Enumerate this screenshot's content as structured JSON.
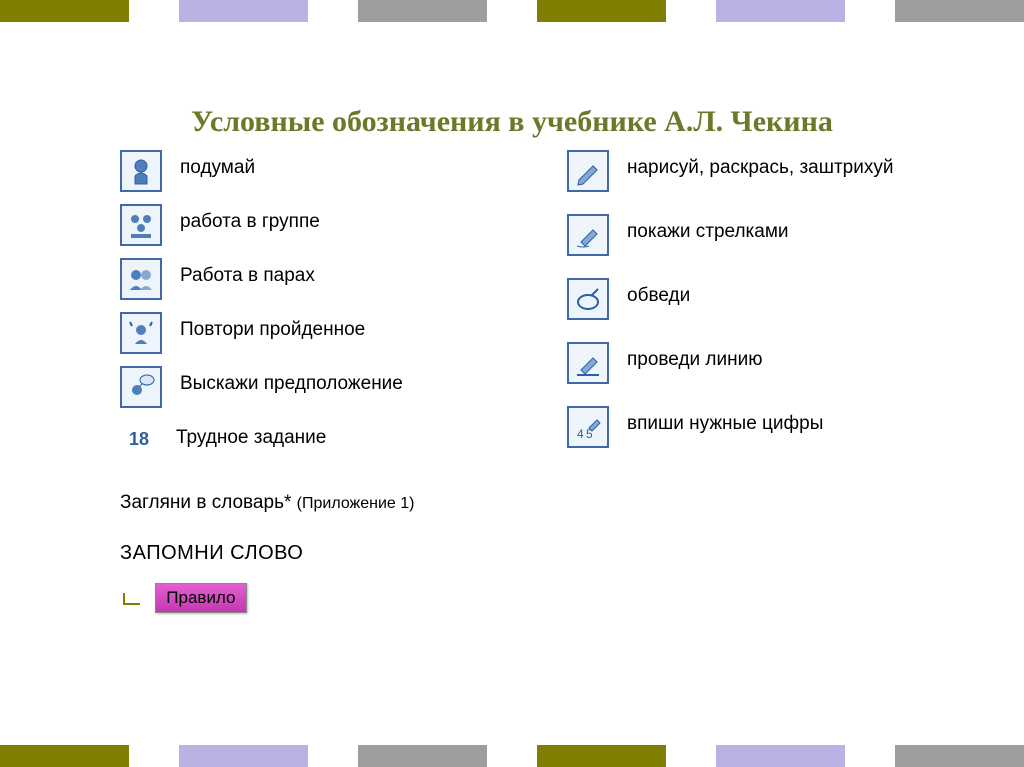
{
  "title": "Условные обозначения в учебнике А.Л. Чекина",
  "left": {
    "think": "подумай",
    "group": "работа в группе",
    "pairs": "Работа в парах",
    "repeat": "Повтори пройденное",
    "guess": "Выскажи предположение",
    "hard_num": "18",
    "hard": "Трудное задание"
  },
  "right": {
    "draw": "нарисуй, раскрась, заштрихуй",
    "arrows": "покажи стрелками",
    "circle": "обведи",
    "line": "проведи линию",
    "digits": "впиши нужные цифры"
  },
  "footer": {
    "dict": "Загляни в словарь*",
    "appendix": "(Приложение 1)",
    "remember": "ЗАПОМНИ СЛОВО",
    "rule": "Правило"
  }
}
